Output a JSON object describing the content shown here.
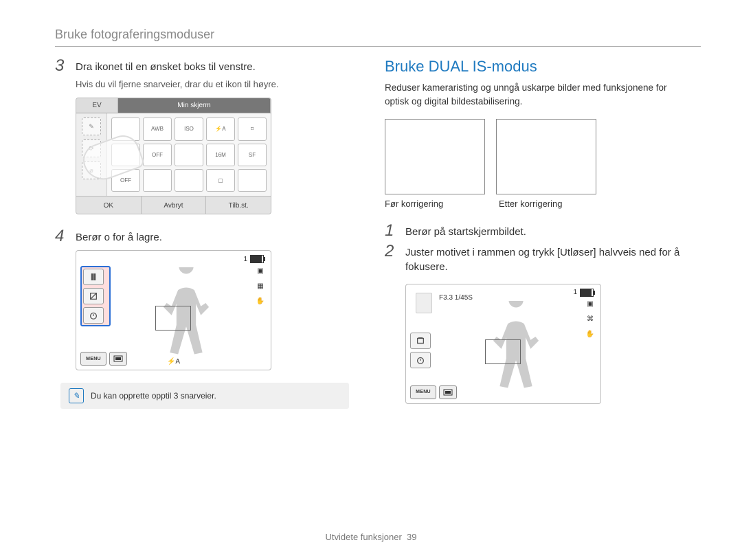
{
  "breadcrumb": "Bruke fotograferingsmoduser",
  "left": {
    "step3": {
      "num": "3",
      "text": "Dra ikonet til en ønsket boks til venstre.",
      "sub": "Hvis du vil fjerne snarveier, drar du et ikon til høyre."
    },
    "step4": {
      "num": "4",
      "text": "Berør o for å lagre."
    },
    "cam1": {
      "tabEV": "EV",
      "tabMyScreen": "Min skjerm",
      "cells": [
        "",
        "AWB",
        "ISO",
        "⚡A",
        "⌑",
        "",
        "OFF",
        "",
        "16M",
        "SF",
        "OFF",
        "",
        "",
        "▢",
        ""
      ],
      "btnOK": "OK",
      "btnCancel": "Avbryt",
      "btnReset": "Tilb.st."
    },
    "cam2": {
      "topCount": "1",
      "menuLabel": "MENU",
      "flash": "⚡A"
    },
    "note": "Du kan opprette opptil 3 snarveier."
  },
  "right": {
    "title": "Bruke DUAL IS-modus",
    "desc": "Reduser kameraristing og unngå uskarpe bilder med funksjonene for optisk og digital bildestabilisering.",
    "beforeLabel": "Før korrigering",
    "afterLabel": "Etter korrigering",
    "step1": {
      "num": "1",
      "text": "Berør på startskjermbildet."
    },
    "step2": {
      "num": "2",
      "text": "Juster motivet i rammen og trykk [Utløser] halvveis ned for å fokusere."
    },
    "cam3": {
      "topCount": "1",
      "exposure": "F3.3   1/45S",
      "menuLabel": "MENU"
    }
  },
  "footer": {
    "text": "Utvidete funksjoner",
    "page": "39"
  }
}
